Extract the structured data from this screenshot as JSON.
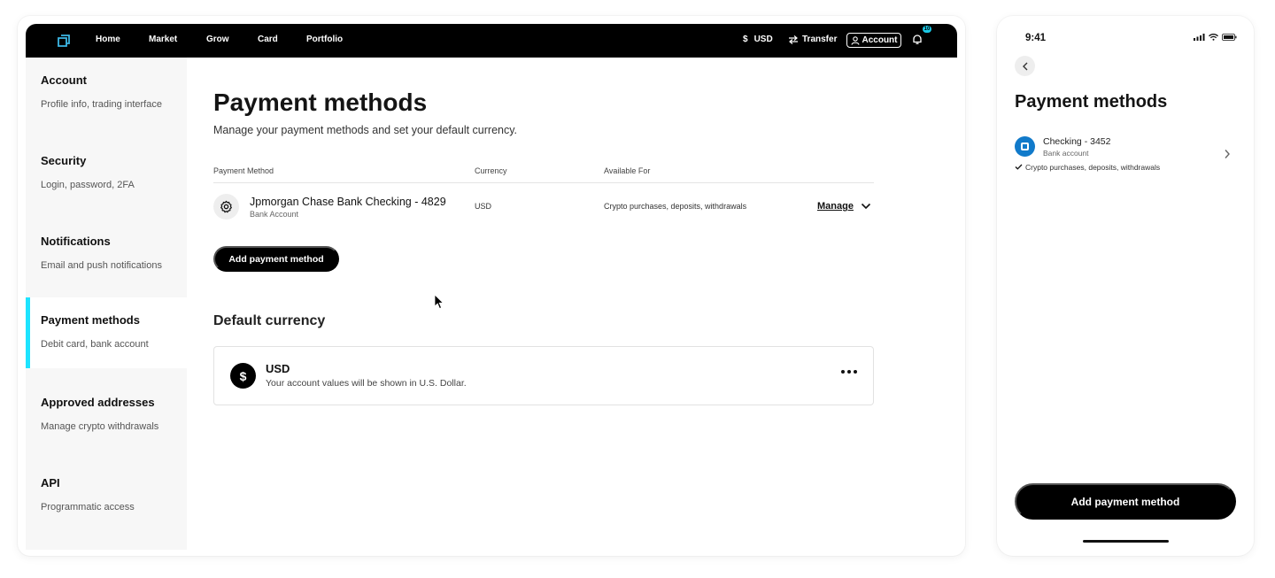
{
  "nav": {
    "links": [
      "Home",
      "Market",
      "Grow",
      "Card",
      "Portfolio"
    ],
    "currency": "USD",
    "currency_symbol": "$",
    "transfer": "Transfer",
    "account": "Account",
    "notification_count": "10"
  },
  "sidebar": {
    "items": [
      {
        "title": "Account",
        "subtitle": "Profile info, trading interface"
      },
      {
        "title": "Security",
        "subtitle": "Login, password, 2FA"
      },
      {
        "title": "Notifications",
        "subtitle": "Email and push notifications"
      },
      {
        "title": "Payment methods",
        "subtitle": "Debit card, bank account"
      },
      {
        "title": "Approved addresses",
        "subtitle": "Manage crypto withdrawals"
      },
      {
        "title": "API",
        "subtitle": "Programmatic access"
      }
    ],
    "active_index": 3
  },
  "main": {
    "title": "Payment methods",
    "subtitle": "Manage your payment methods and set your default currency.",
    "table_headers": [
      "Payment Method",
      "Currency",
      "Available For"
    ],
    "payment_method": {
      "name": "Jpmorgan Chase Bank Checking - 4829",
      "type": "Bank Account",
      "currency": "USD",
      "available_for": "Crypto purchases, deposits, withdrawals",
      "manage_label": "Manage"
    },
    "add_button": "Add payment method",
    "default_currency": {
      "section_title": "Default currency",
      "code": "USD",
      "symbol": "$",
      "description": "Your account values will be shown in U.S. Dollar."
    }
  },
  "phone": {
    "time": "9:41",
    "title": "Payment methods",
    "account": {
      "name": "Checking - 3452",
      "type": "Bank account",
      "available_for": "Crypto purchases, deposits, withdrawals"
    },
    "add_button": "Add payment method"
  },
  "colors": {
    "accent": "#1de4ff",
    "bank_blue": "#117aca",
    "nav_bg": "#000000"
  }
}
